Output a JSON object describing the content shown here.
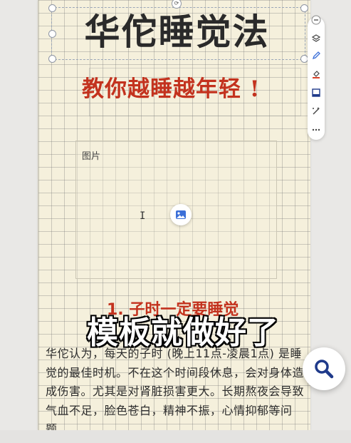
{
  "document": {
    "title": "华佗睡觉法",
    "subtitle": "教你越睡越年轻 !",
    "image_placeholder_label": "图片",
    "section_heading": "1. 子时一定要睡觉",
    "body_text": "华佗认为，每天的子时 (晚上11点-凌晨1点) 是睡觉的最佳时机。不在这个时间段休息，会对身体造成伤害。尤其是对肾脏损害更大。长期熬夜会导致气血不足，脸色苍白，精神不振，心情抑郁等问题。",
    "cursor_glyph": "I"
  },
  "overlay": {
    "caption": "模板就做好了"
  },
  "toolbar": {
    "items": [
      "collapse-icon",
      "layers-icon",
      "pen-icon",
      "fill-color-icon",
      "frame-icon",
      "magic-tools-icon",
      "more-icon"
    ]
  },
  "colors": {
    "title": "#2a2a2a",
    "accent_red": "#c3321e",
    "page_bg": "#f5f0dc",
    "fab_icon": "#1f3a8a"
  }
}
